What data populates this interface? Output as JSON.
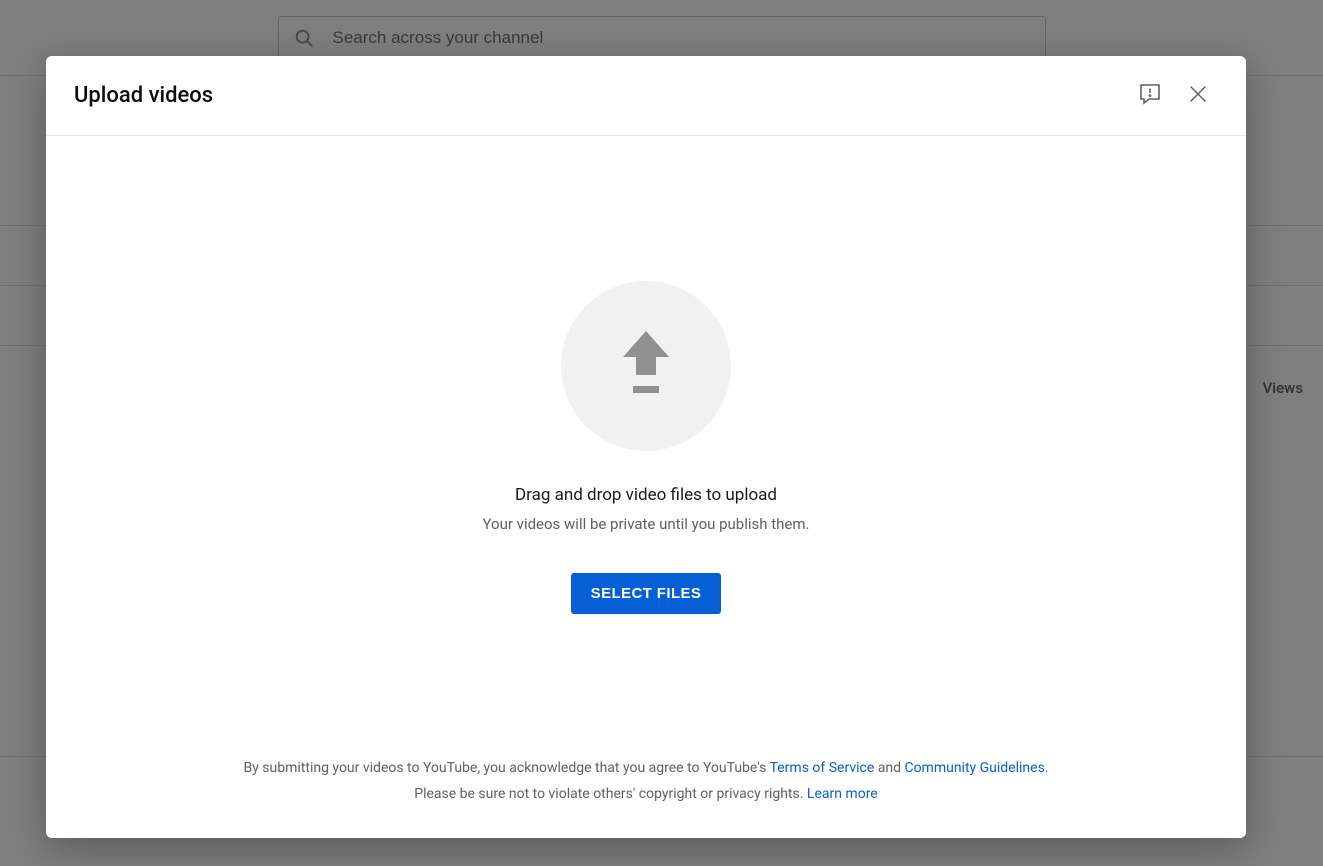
{
  "search": {
    "placeholder": "Search across your channel"
  },
  "background": {
    "column_label": "Views"
  },
  "modal": {
    "title": "Upload videos",
    "drag_title": "Drag and drop video files to upload",
    "drag_sub": "Your videos will be private until you publish them.",
    "select_btn": "SELECT FILES",
    "footer": {
      "line1_pre": "By submitting your videos to YouTube, you acknowledge that you agree to YouTube's ",
      "tos": "Terms of Service",
      "and": " and ",
      "cg": "Community Guidelines",
      "line1_post": ".",
      "line2_pre": "Please be sure not to violate others' copyright or privacy rights. ",
      "learn": "Learn more"
    }
  }
}
